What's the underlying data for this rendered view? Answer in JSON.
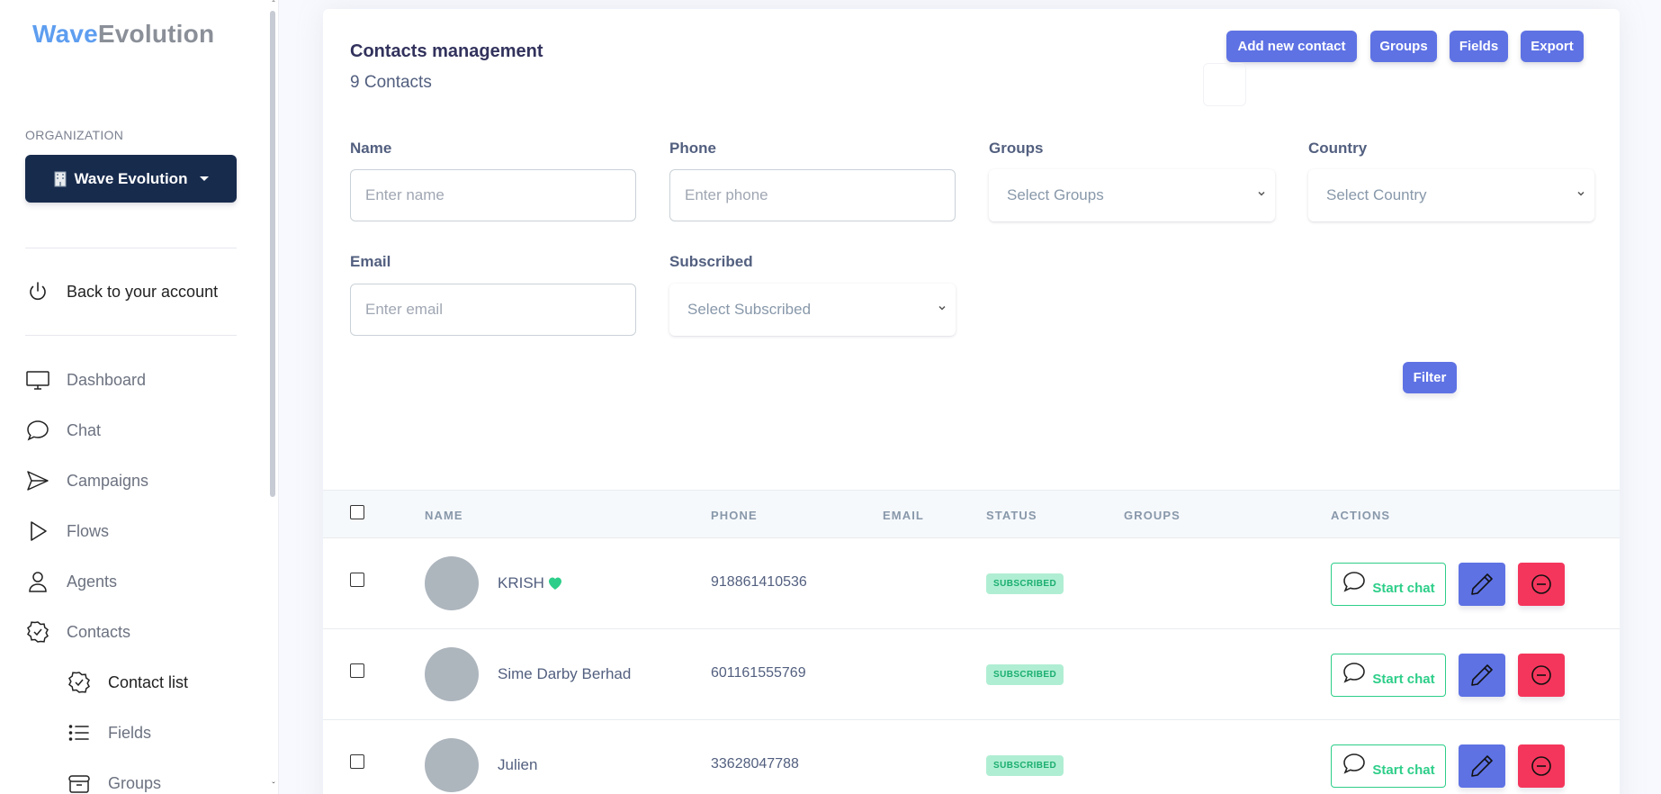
{
  "sidebar": {
    "logo_part1": "Wave",
    "logo_part2": "Evolution",
    "org_label": "ORGANIZATION",
    "org_button": "Wave Evolution",
    "back_label": "Back to your account",
    "items": [
      {
        "label": "Dashboard",
        "icon": "monitor-icon"
      },
      {
        "label": "Chat",
        "icon": "chat-bubble-icon"
      },
      {
        "label": "Campaigns",
        "icon": "send-icon"
      },
      {
        "label": "Flows",
        "icon": "play-icon"
      },
      {
        "label": "Agents",
        "icon": "user-icon"
      },
      {
        "label": "Contacts",
        "icon": "badge-check-icon"
      }
    ],
    "sub_items": [
      {
        "label": "Contact list",
        "icon": "badge-check-icon"
      },
      {
        "label": "Fields",
        "icon": "list-icon"
      },
      {
        "label": "Groups",
        "icon": "archive-icon"
      }
    ]
  },
  "header": {
    "title": "Contacts management",
    "count": "9 Contacts",
    "buttons": {
      "add": "Add new contact",
      "groups": "Groups",
      "fields": "Fields",
      "export": "Export"
    }
  },
  "filters": {
    "name_label": "Name",
    "name_placeholder": "Enter name",
    "phone_label": "Phone",
    "phone_placeholder": "Enter phone",
    "groups_label": "Groups",
    "groups_selected": "Select Groups",
    "country_label": "Country",
    "country_selected": "Select Country",
    "email_label": "Email",
    "email_placeholder": "Enter email",
    "subscribed_label": "Subscribed",
    "subscribed_selected": "Select Subscribed",
    "filter_button": "Filter"
  },
  "table": {
    "columns": [
      "NAME",
      "PHONE",
      "EMAIL",
      "STATUS",
      "GROUPS",
      "ACTIONS"
    ],
    "rows": [
      {
        "name": "KRISH",
        "heart": true,
        "phone": "918861410536",
        "email": "",
        "status": "SUBSCRIBED",
        "groups": ""
      },
      {
        "name": "Sime Darby Berhad",
        "heart": false,
        "phone": "601161555769",
        "email": "",
        "status": "SUBSCRIBED",
        "groups": ""
      },
      {
        "name": "Julien",
        "heart": false,
        "phone": "33628047788",
        "email": "",
        "status": "SUBSCRIBED",
        "groups": ""
      }
    ],
    "start_chat_label": "Start chat"
  },
  "colors": {
    "primary": "#5e72e4",
    "success": "#2dce89",
    "danger": "#f5365c",
    "dark": "#172b4d"
  }
}
